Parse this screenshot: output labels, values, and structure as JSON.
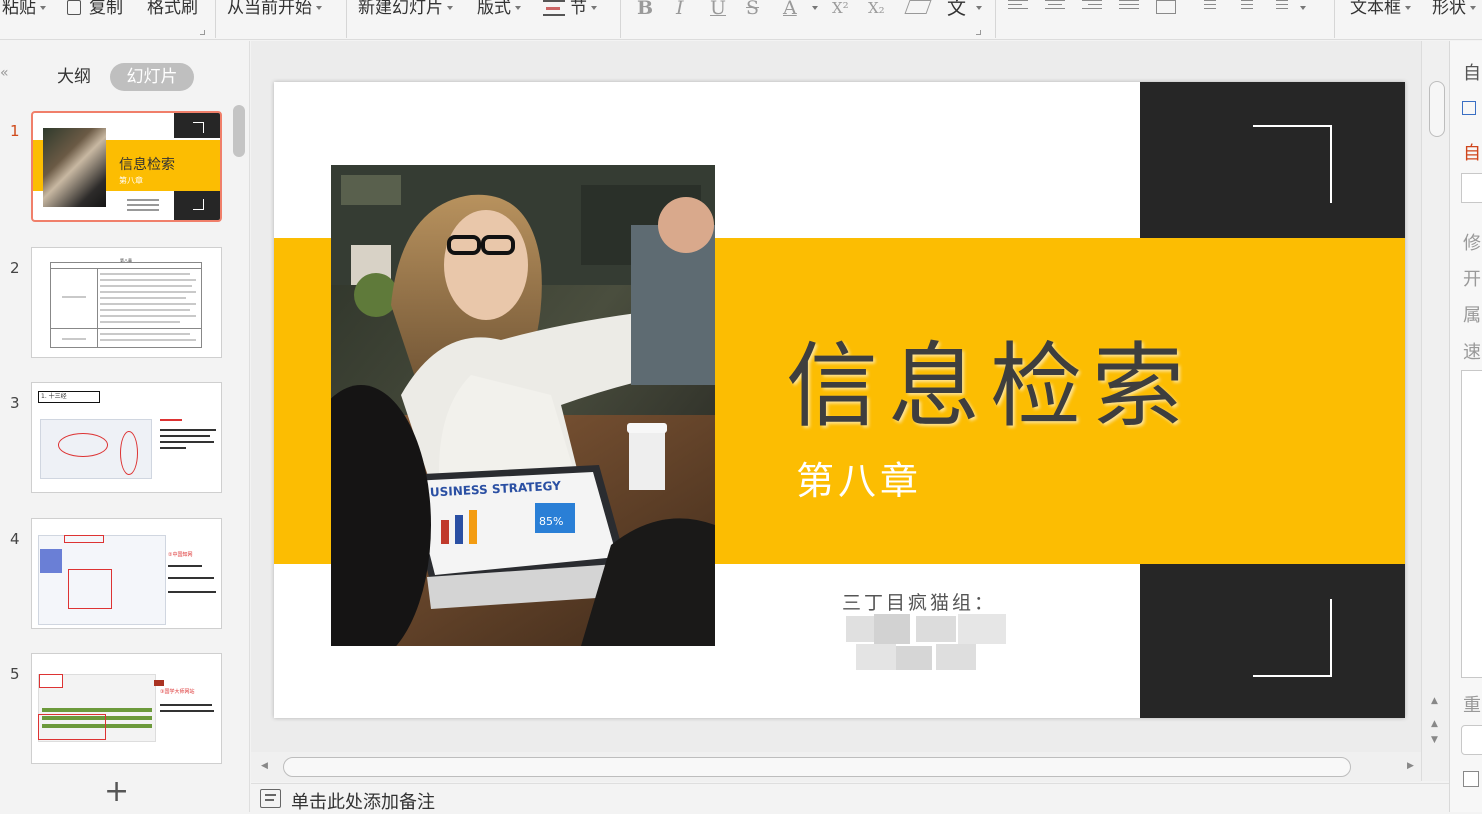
{
  "ribbon": {
    "paste_label": "粘贴",
    "copy_label": "复制",
    "format_painter_label": "格式刷",
    "from_current_label": "从当前开始",
    "new_slide_label": "新建幻灯片",
    "layout_label": "版式",
    "section_label": "节",
    "format_icons": [
      "bold-icon",
      "italic-icon",
      "underline-icon",
      "strikethrough-icon",
      "font-color-icon",
      "superscript-icon",
      "subscript-icon",
      "clear-format-icon",
      "phonetic-guide-icon"
    ],
    "bold_glyph": "B",
    "italic_glyph": "I",
    "underline_glyph": "U",
    "strike_glyph": "S",
    "font_color_glyph": "A",
    "superscript_glyph": "X²",
    "subscript_glyph": "X₂",
    "phonetic_glyph": "文",
    "textbox_label": "文本框",
    "shape_label": "形状"
  },
  "left_panel": {
    "tab_outline": "大纲",
    "tab_slides": "幻灯片",
    "collapse_glyph": "«",
    "add_glyph": "+",
    "slides": [
      {
        "num": "1",
        "title": "信息检索",
        "subtitle": "第八章"
      },
      {
        "num": "2",
        "header": "第八章"
      },
      {
        "num": "3",
        "heading": "1. 十三经"
      },
      {
        "num": "4",
        "note": "②中国知网"
      },
      {
        "num": "5",
        "note": "③国学大师网站"
      }
    ]
  },
  "slide": {
    "title": "信息检索",
    "subtitle": "第八章",
    "author": "三丁目疯猫组：",
    "photo_caption": "BUSINESS STRATEGY",
    "photo_percent": "85%",
    "colors": {
      "band": "#fcbd02",
      "dark": "#262626",
      "title": "#3e3e3e"
    }
  },
  "notes": {
    "placeholder": "单击此处添加备注"
  },
  "right_pane": {
    "labels": [
      "自",
      "自",
      "修",
      "开",
      "属",
      "速",
      "重"
    ]
  }
}
